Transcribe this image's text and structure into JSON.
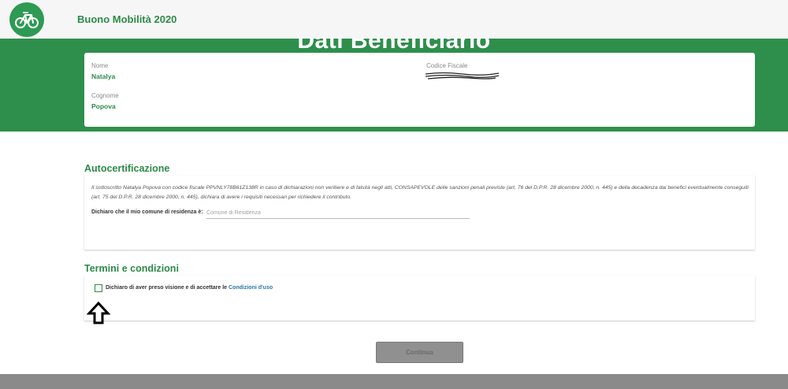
{
  "header": {
    "app_title": "Buono Mobilità 2020",
    "logo_icon": "bicycle-icon",
    "brand_color": "#2e8f4c"
  },
  "banner": {
    "title": "Dati Beneficiario"
  },
  "beneficiary": {
    "nome_label": "Nome",
    "nome_value": "Natalya",
    "cognome_label": "Cognome",
    "cognome_value": "Popova",
    "cf_label": "Codice Fiscale"
  },
  "autocertificazione": {
    "title": "Autocertificazione",
    "text": "Il sottoscritto Natalya Popova con codice fiscale PPVNLY78B61Z138R in caso di dichiarazioni non veritiere e di falsità negli atti, CONSAPEVOLE delle sanzioni penali previste (art. 76 del D.P.R. 28 dicembre 2000, n. 445) e della decadenza dai benefici eventualmente conseguiti (art. 75 del D.P.R. 28 dicembre 2000, n. 445), dichiara di avere i requisiti necessari per richiedere il contributo.",
    "residenza_label": "Dichiaro che il mio comune di residenza è:",
    "residenza_placeholder": "Comune di Residenza",
    "residenza_value": ""
  },
  "terms": {
    "title": "Termini e condizioni",
    "checkbox_text": "Dichiaro di aver preso visione e di accettare le ",
    "link_text": "Condizioni d'uso",
    "checked": false,
    "link_color": "#2a77a8"
  },
  "actions": {
    "continue_label": "Continua"
  }
}
